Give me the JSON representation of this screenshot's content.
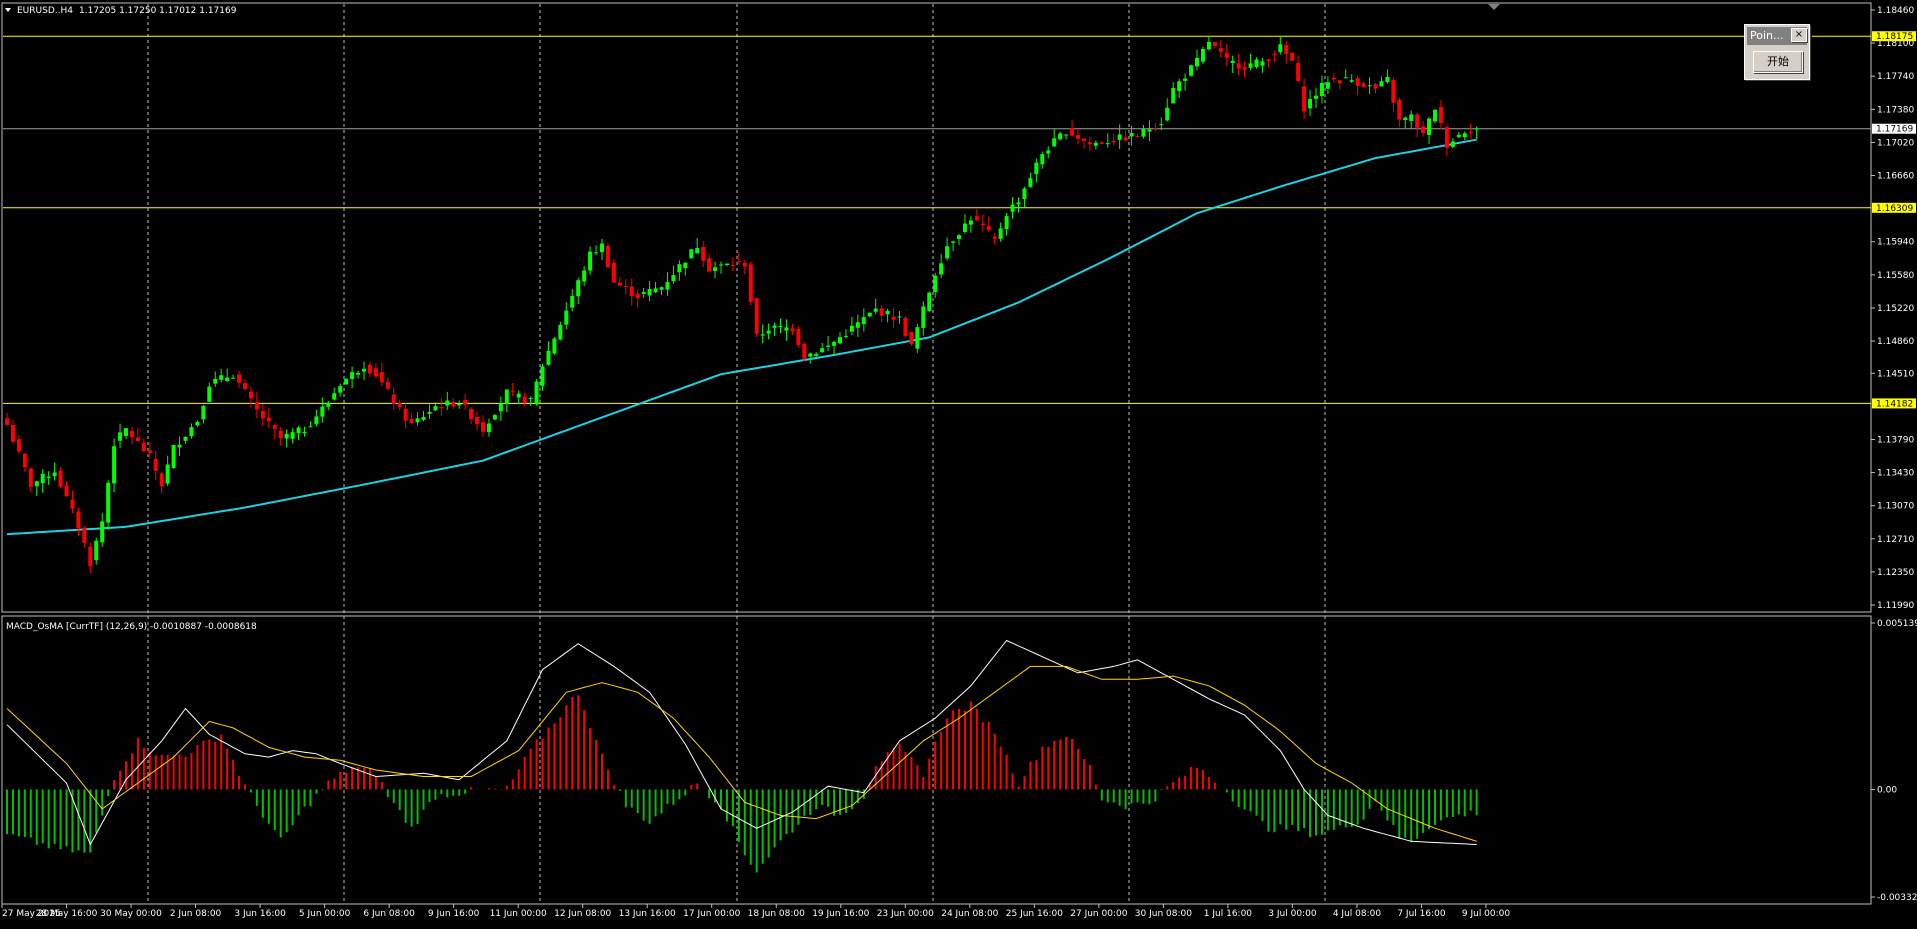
{
  "header": {
    "symbol_label": "EURUSD..H4",
    "ohlc_text": "1.17205 1.17250 1.17012 1.17169",
    "indicator_label": "MACD_OsMA [CurrTF] (12,26,9) -0.0010887 -0.0008618"
  },
  "dialog": {
    "title": "Poin...",
    "close_glyph": "×",
    "start_label": "开始"
  },
  "colors": {
    "background": "#000000",
    "grid": "#c0c0c0",
    "bull_candle": "#00ff00",
    "bear_candle": "#ff0000",
    "moving_average": "#1fd2e0",
    "horizontal_level": "#ffff00",
    "price_line": "#a0a0a0",
    "macd_line": "#ffffff",
    "signal_line": "#ffd700",
    "hist_positive": "#ff0000",
    "hist_negative": "#00c000"
  },
  "chart_data": [
    {
      "type": "candlestick",
      "symbol": "EURUSD..",
      "timeframe": "H4",
      "ylim": [
        1.1199,
        1.1846
      ],
      "y_ticks": [
        "1.18460",
        "1.18100",
        "1.17740",
        "1.17380",
        "1.17020",
        "1.16660",
        "1.15940",
        "1.15580",
        "1.15220",
        "1.14860",
        "1.14510",
        "1.13790",
        "1.13430",
        "1.13070",
        "1.12710",
        "1.12350",
        "1.11990"
      ],
      "x_labels": [
        "27 May 2025",
        "28 May 16:00",
        "30 May 00:00",
        "2 Jun 08:00",
        "3 Jun 16:00",
        "5 Jun 00:00",
        "6 Jun 08:00",
        "9 Jun 16:00",
        "11 Jun 00:00",
        "12 Jun 08:00",
        "13 Jun 16:00",
        "17 Jun 00:00",
        "18 Jun 08:00",
        "19 Jun 16:00",
        "23 Jun 00:00",
        "24 Jun 08:00",
        "25 Jun 16:00",
        "27 Jun 00:00",
        "30 Jun 08:00",
        "1 Jul 16:00",
        "3 Jul 00:00",
        "4 Jul 08:00",
        "7 Jul 16:00",
        "9 Jul 00:00"
      ],
      "horizontal_levels": [
        "1.18175",
        "1.16309",
        "1.14182"
      ],
      "current_price": "1.17169",
      "close_anchors": [
        [
          0,
          1.1395
        ],
        [
          4,
          1.133
        ],
        [
          8,
          1.1345
        ],
        [
          12,
          1.1285
        ],
        [
          14,
          1.1245
        ],
        [
          16,
          1.129
        ],
        [
          18,
          1.1375
        ],
        [
          20,
          1.139
        ],
        [
          24,
          1.136
        ],
        [
          26,
          1.133
        ],
        [
          28,
          1.137
        ],
        [
          32,
          1.14
        ],
        [
          34,
          1.144
        ],
        [
          38,
          1.145
        ],
        [
          42,
          1.141
        ],
        [
          46,
          1.138
        ],
        [
          50,
          1.139
        ],
        [
          54,
          1.142
        ],
        [
          56,
          1.144
        ],
        [
          60,
          1.146
        ],
        [
          62,
          1.145
        ],
        [
          66,
          1.141
        ],
        [
          68,
          1.1395
        ],
        [
          72,
          1.1415
        ],
        [
          76,
          1.142
        ],
        [
          80,
          1.139
        ],
        [
          84,
          1.143
        ],
        [
          88,
          1.142
        ],
        [
          90,
          1.146
        ],
        [
          94,
          1.152
        ],
        [
          98,
          1.158
        ],
        [
          100,
          1.159
        ],
        [
          102,
          1.155
        ],
        [
          106,
          1.1535
        ],
        [
          110,
          1.1545
        ],
        [
          114,
          1.1575
        ],
        [
          116,
          1.159
        ],
        [
          118,
          1.1565
        ],
        [
          122,
          1.157
        ],
        [
          124,
          1.157
        ],
        [
          126,
          1.149
        ],
        [
          128,
          1.15
        ],
        [
          132,
          1.15
        ],
        [
          134,
          1.147
        ],
        [
          138,
          1.148
        ],
        [
          142,
          1.15
        ],
        [
          146,
          1.152
        ],
        [
          148,
          1.1515
        ],
        [
          150,
          1.151
        ],
        [
          152,
          1.148
        ],
        [
          154,
          1.152
        ],
        [
          156,
          1.156
        ],
        [
          158,
          1.159
        ],
        [
          162,
          1.162
        ],
        [
          164,
          1.161
        ],
        [
          166,
          1.1595
        ],
        [
          168,
          1.1625
        ],
        [
          170,
          1.164
        ],
        [
          174,
          1.169
        ],
        [
          178,
          1.1715
        ],
        [
          182,
          1.17
        ],
        [
          186,
          1.1705
        ],
        [
          190,
          1.171
        ],
        [
          194,
          1.1725
        ],
        [
          196,
          1.176
        ],
        [
          200,
          1.179
        ],
        [
          202,
          1.1812
        ],
        [
          205,
          1.179
        ],
        [
          208,
          1.1785
        ],
        [
          211,
          1.179
        ],
        [
          214,
          1.1805
        ],
        [
          216,
          1.179
        ],
        [
          218,
          1.174
        ],
        [
          222,
          1.177
        ],
        [
          226,
          1.177
        ],
        [
          230,
          1.176
        ],
        [
          232,
          1.177
        ],
        [
          234,
          1.1725
        ],
        [
          236,
          1.173
        ],
        [
          238,
          1.171
        ],
        [
          240,
          1.174
        ],
        [
          242,
          1.17
        ],
        [
          245,
          1.1715
        ],
        [
          247,
          1.1717
        ]
      ],
      "ma_anchors": [
        [
          0,
          1.1276
        ],
        [
          20,
          1.1284
        ],
        [
          40,
          1.1305
        ],
        [
          60,
          1.133
        ],
        [
          80,
          1.1356
        ],
        [
          100,
          1.1403
        ],
        [
          120,
          1.145
        ],
        [
          140,
          1.1472
        ],
        [
          155,
          1.149
        ],
        [
          170,
          1.1528
        ],
        [
          185,
          1.1575
        ],
        [
          200,
          1.1625
        ],
        [
          215,
          1.1656
        ],
        [
          230,
          1.1685
        ],
        [
          247,
          1.1705
        ]
      ]
    },
    {
      "type": "histogram+line",
      "name": "MACD_OsMA",
      "ylim": [
        -0.00332,
        0.005139
      ],
      "y_ticks": [
        "0.0051394",
        "0.00",
        "-0.003320"
      ],
      "hist_anchors": [
        [
          0,
          -0.0014
        ],
        [
          8,
          -0.0018
        ],
        [
          14,
          -0.002
        ],
        [
          18,
          0.0004
        ],
        [
          22,
          0.0015
        ],
        [
          26,
          0.001
        ],
        [
          30,
          0.0011
        ],
        [
          36,
          0.0017
        ],
        [
          40,
          0.0001
        ],
        [
          42,
          -0.0005
        ],
        [
          46,
          -0.0016
        ],
        [
          50,
          -0.0006
        ],
        [
          54,
          0.0002
        ],
        [
          58,
          0.0007
        ],
        [
          62,
          0.0005
        ],
        [
          64,
          -0.0002
        ],
        [
          68,
          -0.0012
        ],
        [
          72,
          -0.0002
        ],
        [
          78,
          -5e-05
        ],
        [
          84,
          0.0
        ],
        [
          88,
          0.0012
        ],
        [
          96,
          0.003
        ],
        [
          100,
          0.001
        ],
        [
          104,
          -0.0005
        ],
        [
          108,
          -0.001
        ],
        [
          112,
          -0.0004
        ],
        [
          116,
          0.0002
        ],
        [
          120,
          -0.0005
        ],
        [
          124,
          -0.002
        ],
        [
          126,
          -0.0025
        ],
        [
          130,
          -0.0016
        ],
        [
          136,
          -0.0005
        ],
        [
          140,
          -0.0008
        ],
        [
          144,
          -0.0002
        ],
        [
          146,
          0.0008
        ],
        [
          150,
          0.0013
        ],
        [
          154,
          0.0005
        ],
        [
          158,
          0.0023
        ],
        [
          162,
          0.0026
        ],
        [
          166,
          0.0018
        ],
        [
          170,
          0.0002
        ],
        [
          174,
          0.0013
        ],
        [
          178,
          0.0017
        ],
        [
          182,
          0.0007
        ],
        [
          184,
          -0.0003
        ],
        [
          188,
          -0.0005
        ],
        [
          192,
          -0.0004
        ],
        [
          196,
          0.0002
        ],
        [
          200,
          0.0007
        ],
        [
          204,
          0.0001
        ],
        [
          208,
          -0.0006
        ],
        [
          212,
          -0.0012
        ],
        [
          216,
          -0.0012
        ],
        [
          220,
          -0.0014
        ],
        [
          224,
          -0.0012
        ],
        [
          228,
          -0.0009
        ],
        [
          230,
          -0.0003
        ],
        [
          234,
          -0.0015
        ],
        [
          236,
          -0.0016
        ],
        [
          240,
          -0.001
        ],
        [
          244,
          -0.0008
        ],
        [
          247,
          -0.0007
        ]
      ],
      "macd_anchors": [
        [
          0,
          0.002
        ],
        [
          10,
          0.0002
        ],
        [
          14,
          -0.0017
        ],
        [
          20,
          0.0003
        ],
        [
          26,
          0.0015
        ],
        [
          30,
          0.0025
        ],
        [
          34,
          0.0017
        ],
        [
          40,
          0.0011
        ],
        [
          44,
          0.001
        ],
        [
          48,
          0.0012
        ],
        [
          52,
          0.0011
        ],
        [
          56,
          0.0008
        ],
        [
          62,
          0.0004
        ],
        [
          70,
          0.0005
        ],
        [
          76,
          0.0003
        ],
        [
          84,
          0.0015
        ],
        [
          90,
          0.0037
        ],
        [
          96,
          0.0045
        ],
        [
          102,
          0.0038
        ],
        [
          108,
          0.003
        ],
        [
          114,
          0.0014
        ],
        [
          120,
          -0.0006
        ],
        [
          126,
          -0.0012
        ],
        [
          132,
          -0.0007
        ],
        [
          138,
          0.0001
        ],
        [
          144,
          -0.0001
        ],
        [
          150,
          0.0015
        ],
        [
          156,
          0.0022
        ],
        [
          162,
          0.0032
        ],
        [
          168,
          0.0046
        ],
        [
          174,
          0.0041
        ],
        [
          180,
          0.0036
        ],
        [
          186,
          0.0038
        ],
        [
          190,
          0.004
        ],
        [
          196,
          0.0034
        ],
        [
          202,
          0.0028
        ],
        [
          208,
          0.0023
        ],
        [
          214,
          0.0012
        ],
        [
          218,
          0.0
        ],
        [
          222,
          -0.0008
        ],
        [
          228,
          -0.0012
        ],
        [
          236,
          -0.0016
        ],
        [
          247,
          -0.0017
        ]
      ],
      "signal_anchors": [
        [
          0,
          0.0025
        ],
        [
          10,
          0.0008
        ],
        [
          16,
          -0.0006
        ],
        [
          22,
          0.0002
        ],
        [
          28,
          0.001
        ],
        [
          34,
          0.0021
        ],
        [
          38,
          0.0019
        ],
        [
          44,
          0.0013
        ],
        [
          50,
          0.001
        ],
        [
          56,
          0.0009
        ],
        [
          62,
          0.0006
        ],
        [
          70,
          0.0004
        ],
        [
          78,
          0.0004
        ],
        [
          86,
          0.0012
        ],
        [
          94,
          0.003
        ],
        [
          100,
          0.0033
        ],
        [
          106,
          0.003
        ],
        [
          112,
          0.0022
        ],
        [
          118,
          0.001
        ],
        [
          124,
          -0.0004
        ],
        [
          130,
          -0.0008
        ],
        [
          136,
          -0.0009
        ],
        [
          142,
          -0.0005
        ],
        [
          148,
          0.0005
        ],
        [
          154,
          0.0015
        ],
        [
          160,
          0.0022
        ],
        [
          166,
          0.003
        ],
        [
          172,
          0.0038
        ],
        [
          178,
          0.0038
        ],
        [
          184,
          0.0034
        ],
        [
          190,
          0.0034
        ],
        [
          196,
          0.0035
        ],
        [
          202,
          0.0032
        ],
        [
          208,
          0.0026
        ],
        [
          214,
          0.0018
        ],
        [
          220,
          0.0008
        ],
        [
          226,
          0.0002
        ],
        [
          232,
          -0.0006
        ],
        [
          240,
          -0.0012
        ],
        [
          247,
          -0.0016
        ]
      ]
    }
  ]
}
